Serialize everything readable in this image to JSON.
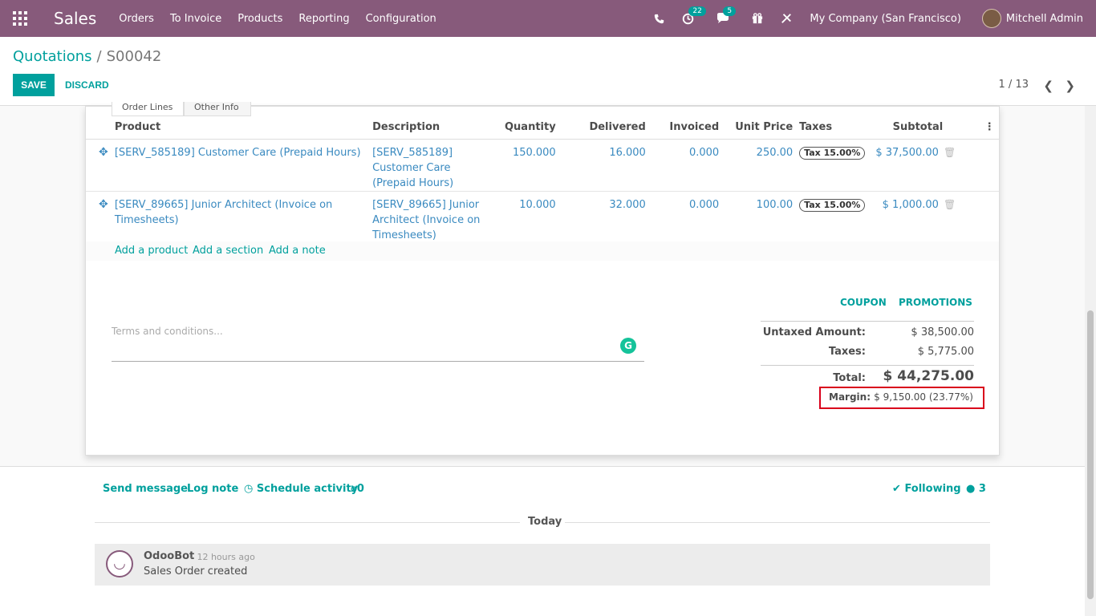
{
  "navbar": {
    "app_title": "Sales",
    "menu": [
      "Orders",
      "To Invoice",
      "Products",
      "Reporting",
      "Configuration"
    ],
    "activity_count": "22",
    "messages_count": "5",
    "company": "My Company (San Francisco)",
    "user": "Mitchell Admin"
  },
  "control": {
    "breadcrumb_root": "Quotations",
    "breadcrumb_sep": "/",
    "breadcrumb_current": "S00042",
    "save_label": "SAVE",
    "discard_label": "DISCARD",
    "pager": "1 / 13"
  },
  "tabs": [
    "Order Lines",
    "Other Info"
  ],
  "order_lines": {
    "headers": [
      "Product",
      "Description",
      "Quantity",
      "Delivered",
      "Invoiced",
      "Unit Price",
      "Taxes",
      "Subtotal"
    ],
    "rows": [
      {
        "product": "[SERV_585189] Customer Care (Prepaid Hours)",
        "description": "[SERV_585189] Customer Care (Prepaid Hours)",
        "quantity": "150.000",
        "delivered": "16.000",
        "invoiced": "0.000",
        "unit_price": "250.00",
        "tax": "Tax 15.00%",
        "subtotal": "$ 37,500.00"
      },
      {
        "product": "[SERV_89665] Junior Architect (Invoice on Timesheets)",
        "description": "[SERV_89665] Junior Architect (Invoice on Timesheets)",
        "quantity": "10.000",
        "delivered": "32.000",
        "invoiced": "0.000",
        "unit_price": "100.00",
        "tax": "Tax 15.00%",
        "subtotal": "$ 1,000.00"
      }
    ],
    "add_product": "Add a product",
    "add_section": "Add a section",
    "add_note": "Add a note"
  },
  "actions": {
    "coupon": "COUPON",
    "promotions": "PROMOTIONS"
  },
  "terms_placeholder": "Terms and conditions...",
  "totals": {
    "untaxed_label": "Untaxed Amount:",
    "untaxed_value": "$ 38,500.00",
    "taxes_label": "Taxes:",
    "taxes_value": "$ 5,775.00",
    "total_label": "Total:",
    "total_value": "$ 44,275.00",
    "margin_label": "Margin:",
    "margin_value": "$ 9,150.00 (23.77%)"
  },
  "chatter": {
    "send_message": "Send message",
    "log_note": "Log note",
    "schedule_activity": "Schedule activity",
    "attachments": "0",
    "following": "Following",
    "followers": "3",
    "today": "Today",
    "message": {
      "author": "OdooBot",
      "time": "- 12 hours ago",
      "body": "Sales Order created"
    }
  },
  "colors": {
    "brand": "#875a7b",
    "accent": "#00a09d",
    "link": "#3a8ac0",
    "highlight": "#d9001b"
  }
}
